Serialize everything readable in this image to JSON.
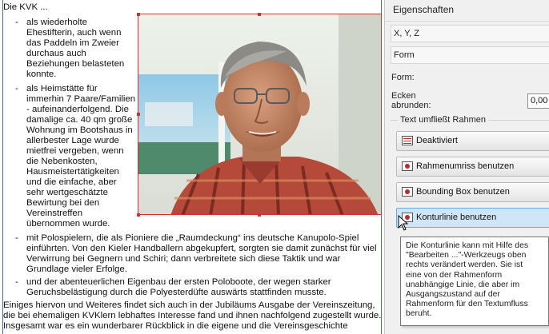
{
  "document": {
    "title_line": "Die KVK ...",
    "bullet_dash": "-",
    "bullet1": [
      "als wiederholte",
      "Ehestifterin, auch wenn",
      "das Paddeln im Zweier",
      "durchaus auch",
      "Beziehungen belasteten",
      "konnte."
    ],
    "bullet2": [
      "als Heimstätte für",
      "immerhin 7 Paare/Familien",
      "- aufeinanderfolgend. Die",
      "damalige ca. 40 qm große",
      "Wohnung im Bootshaus in",
      "allerbester Lage wurde",
      "mietfrei vergeben, wenn",
      "die Nebenkosten,",
      "Hausmeistertätigkeiten",
      "und die einfache,  aber",
      "sehr wertgeschätzte",
      "Bewirtung bei den",
      "Vereinstreffen",
      "übernommen wurde."
    ],
    "bullet3": [
      "mit Polospielern, die als Pioniere die „Raumdeckung“ ins deutsche Kanupolo-Spiel",
      "einführten. Von den Kieler Handballern abgekupfert, sorgten sie damit zunächst für viel",
      "Verwirrung bei Gegnern und Schiri; dann verbreitete sich diese Taktik und war",
      "Grundlage vieler Erfolge."
    ],
    "bullet4": [
      "und der abenteuerlichen Eigenbau der ersten Poloboote, der wegen starker",
      "Geruchsbelästigung durch die Polyesterdüfte auswärts stattfinden musste."
    ],
    "closing": [
      "Einiges hiervon und Weiteres findet sich auch in der Jubiläums Ausgabe der Vereinszeitung,",
      "die bei ehemaligen KVKlern lebhaftes Interesse fand und ihnen nachfolgend zugestellt wurde.",
      "Insgesamt war es ein wunderbarer Rückblick in die eigene und die Vereinsgeschichte"
    ]
  },
  "panel": {
    "title": "Eigenschaften",
    "section_xyz": "X, Y, Z",
    "section_form": "Form",
    "form_label": "Form:",
    "corners_label_1": "Ecken",
    "corners_label_2": "abrunden:",
    "corners_value": "0,00",
    "text_flow_group": "Text umfließt Rahmen",
    "wrap_buttons": [
      "Deaktiviert",
      "Rahmenumriss benutzen",
      "Bounding Box benutzen",
      "Konturlinie benutzen"
    ]
  },
  "tooltip": {
    "lines": [
      "Die Konturlinie kann mit Hilfe des",
      "\"Bearbeiten ...\"-Werkzeugs oben",
      "rechts verändert werden. Sie ist",
      "eine von der Rahmenform",
      "unabhängige Linie, die aber im",
      "Ausgangszustand auf der",
      "Rahmenform für den Textumfluss",
      "beruht."
    ]
  },
  "colors": {
    "frame_border": "#d43030",
    "guide": "#3b6fc4",
    "active_button": "#cfe6f8"
  }
}
